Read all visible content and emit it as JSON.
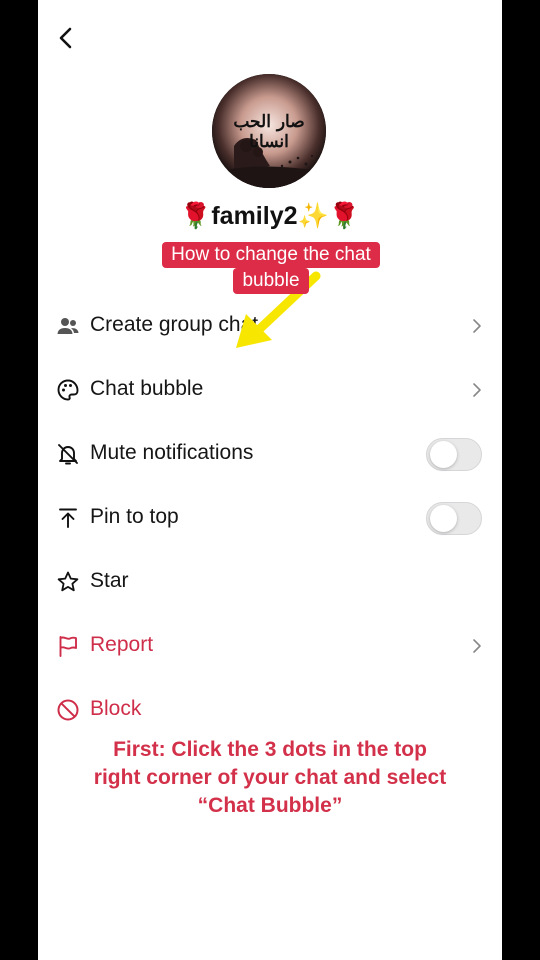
{
  "header": {
    "back_icon": "chevron-left-icon"
  },
  "profile": {
    "avatar_text": "صار الحب انسانا",
    "name": "🌹family2✨🌹"
  },
  "overlay": {
    "caption_line1": "How to change the chat",
    "caption_line2": "bubble",
    "instruction": "First: Click the 3 dots in the top right corner of your chat and select “Chat Bubble”",
    "arrow_color": "#f7e600",
    "caption_bg": "#dd2c47"
  },
  "menu": {
    "items": [
      {
        "label": "Create group chat",
        "icon": "people-icon",
        "trailing": "chevron"
      },
      {
        "label": "Chat bubble",
        "icon": "palette-icon",
        "trailing": "chevron"
      },
      {
        "label": "Mute notifications",
        "icon": "bell-off-icon",
        "trailing": "toggle",
        "on": false
      },
      {
        "label": "Pin to top",
        "icon": "pin-top-icon",
        "trailing": "toggle",
        "on": false
      },
      {
        "label": "Star",
        "icon": "star-icon",
        "trailing": "none"
      },
      {
        "label": "Report",
        "icon": "flag-icon",
        "trailing": "chevron",
        "color": "#cf2e4a"
      },
      {
        "label": "Block",
        "icon": "block-icon",
        "trailing": "none",
        "color": "#cf2e4a"
      }
    ]
  }
}
